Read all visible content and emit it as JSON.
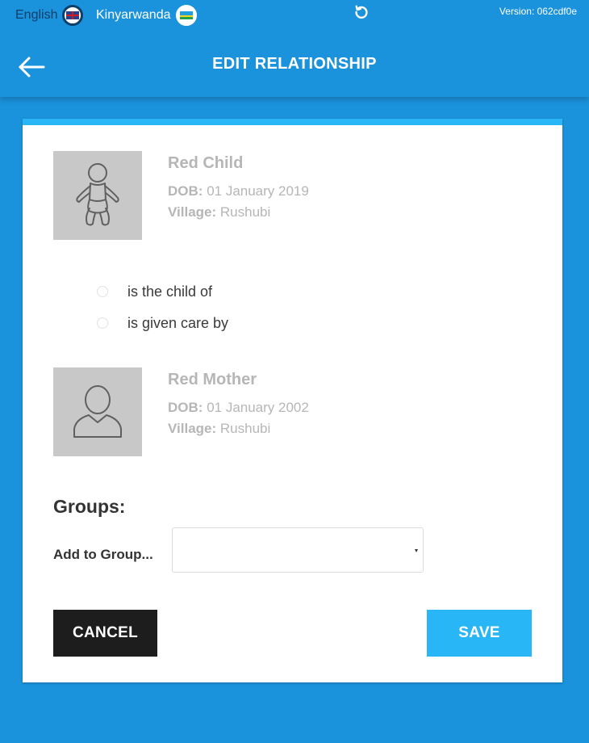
{
  "header": {
    "languages": [
      {
        "label": "English",
        "flag": "uk-flag-icon",
        "active": true
      },
      {
        "label": "Kinyarwanda",
        "flag": "rwanda-flag-icon",
        "active": false
      }
    ],
    "version": "Version: 062cdf0e",
    "title": "EDIT RELATIONSHIP",
    "icons": {
      "back": "arrow-left-icon",
      "refresh": "refresh-icon"
    }
  },
  "card": {
    "accent_color": "#29b6f6",
    "person_a": {
      "name": "Red Child",
      "dob_label": "DOB:",
      "dob": "01 January 2019",
      "village_label": "Village:",
      "village": "Rushubi",
      "avatar_icon": "baby-icon"
    },
    "relationship_options": [
      {
        "label": "is the child of",
        "selected": false
      },
      {
        "label": "is given care by",
        "selected": false
      }
    ],
    "person_b": {
      "name": "Red Mother",
      "dob_label": "DOB:",
      "dob": "01 January 2002",
      "village_label": "Village:",
      "village": "Rushubi",
      "avatar_icon": "adult-person-icon"
    },
    "groups": {
      "heading": "Groups:",
      "add_label": "Add to Group...",
      "selected_value": ""
    },
    "buttons": {
      "cancel": "CANCEL",
      "save": "SAVE"
    }
  },
  "colors": {
    "background": "#1b92dc",
    "primary": "#29b6f6",
    "cancel_button": "#1d1d1d"
  }
}
